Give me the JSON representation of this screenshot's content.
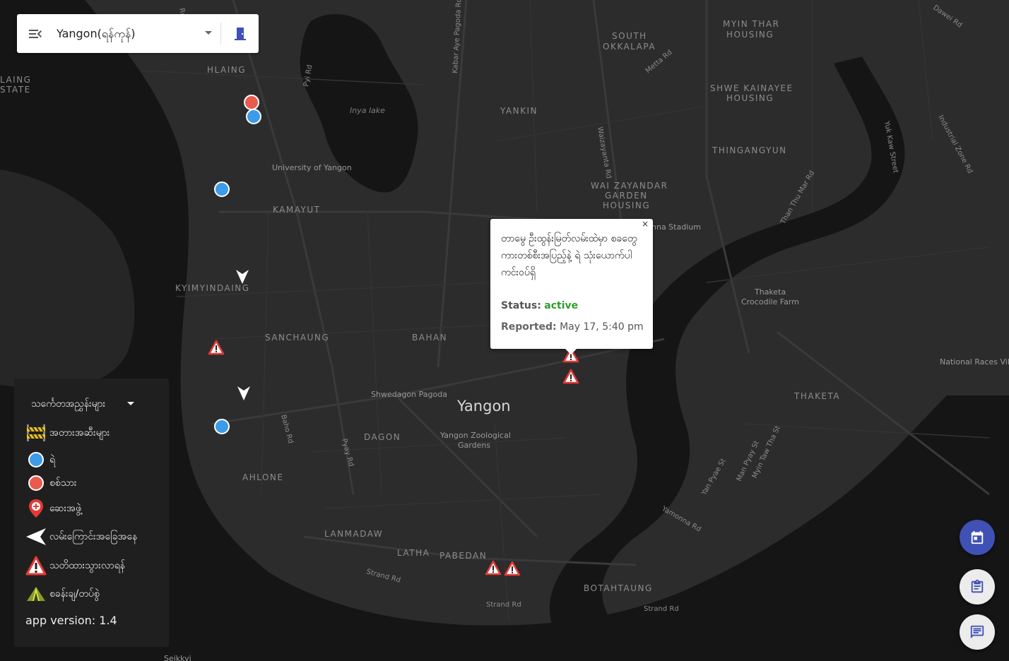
{
  "topbar": {
    "menu_icon": "menu-open-icon",
    "city": "Yangon(ရန်ကုန်)",
    "exit_icon": "exit-door-icon"
  },
  "legend": {
    "title": "သင်္ကေတအညွှန်းများ",
    "items": [
      {
        "icon": "barricade-icon",
        "label": "အတားအဆီးများ"
      },
      {
        "icon": "blue-dot-icon",
        "label": "ရဲ",
        "color": "#3d9be9"
      },
      {
        "icon": "red-dot-icon",
        "label": "စစ်သား",
        "color": "#ea5a4e"
      },
      {
        "icon": "medical-pin-icon",
        "label": "ဆေးအဖွဲ့",
        "color": "#e53935"
      },
      {
        "icon": "direction-arrow-icon",
        "label": "လမ်းကြောင်းအခြေအနေ"
      },
      {
        "icon": "warning-triangle-icon",
        "label": "သတိထားသွားလာရန်"
      },
      {
        "icon": "tent-icon",
        "label": "စခန်းချ/တပ်စွဲ"
      }
    ],
    "version": "app version: 1.4"
  },
  "popup": {
    "close": "×",
    "description": "တာမွေ ဦးထွန်းမြတ်လမ်းထဲမှာ စခတွေ ကားတစ်စီးအပြည့်နဲ့ ရဲ သုံးယောက်ပါ ကင်းဝပ်ရှိ",
    "status_label": "Status:",
    "status_value": "active",
    "status_color": "#2e9e2e",
    "reported_label": "Reported:",
    "reported_value": "May 17, 5:40 pm"
  },
  "fabs": [
    {
      "icon": "calendar-icon"
    },
    {
      "icon": "clipboard-icon"
    },
    {
      "icon": "chat-icon"
    }
  ],
  "map": {
    "city_label": "Yangon",
    "districts": [
      "HLAING",
      "KAMAYUT",
      "KYIMYINDAING",
      "SANCHAUNG",
      "BAHAN",
      "DAGON",
      "AHLONE",
      "LANMADAW",
      "LATHA",
      "PABEDAN",
      "BOTAHTAUNG",
      "YANKIN",
      "SOUTH",
      "OKKALAPA",
      "MYIN THAR",
      "HOUSING",
      "SHWE KAINAYEE",
      "HOUSING",
      "THINGANGYUN",
      "WAI ZAYANDAR",
      "GARDEN",
      "HOUSING",
      "THAKETA",
      "LAING",
      "STATE"
    ],
    "pois": [
      "Inya lake",
      "University of Yangon",
      "Shwedagon Pagoda",
      "Yangon Zoological",
      "Gardens",
      "Thaketa",
      "Crocodile Farm",
      "nna Stadium",
      "National Races Villa",
      "Seikkyi"
    ],
    "roads": [
      "Pyi Rd",
      "Kabar Aye Pagoda Rd",
      "Metta Rd",
      "Waizayanta Rd",
      "Than Thu Mar Rd",
      "Yuk Kaw Street",
      "Industrial Zone Rd",
      "Dawei Rd",
      "Baho Rd",
      "Pyay Rd",
      "Strand Rd",
      "Strand Rd",
      "Strand Rd",
      "Yamonna Rd",
      "Yan Pyae St",
      "Man Pyay St",
      "Myin Taw Tha St",
      "Rd"
    ]
  },
  "markers": {
    "colors": {
      "police": "#3d9be9",
      "soldier": "#ea5a4e",
      "warning": "#e53935"
    }
  }
}
